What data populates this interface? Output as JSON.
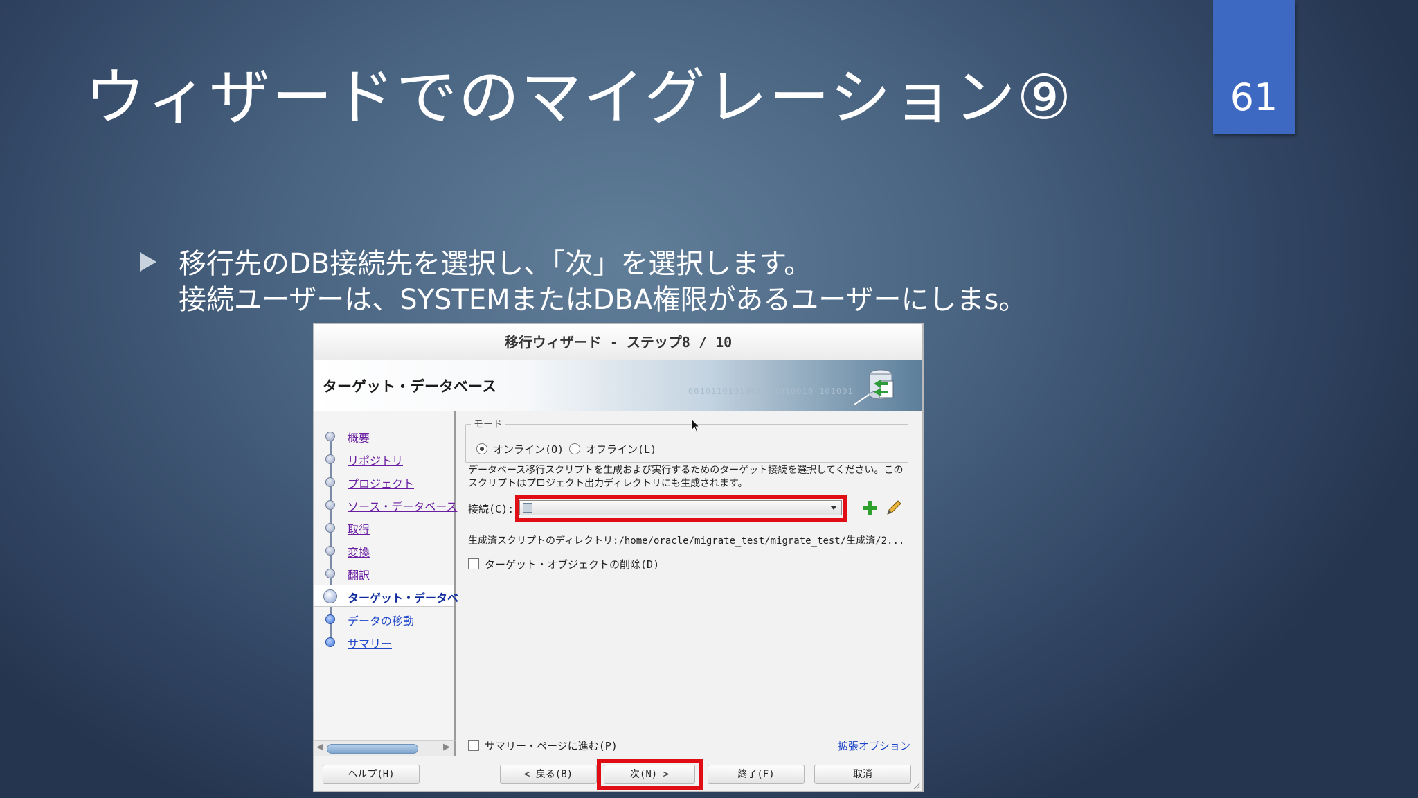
{
  "slide": {
    "title": "ウィザードでのマイグレーション⑨",
    "page_number": "61",
    "bullet_line1": "移行先のDB接続先を選択し、「次」を選択します。",
    "bullet_line2": "接続ユーザーは、SYSTEMまたはDBA権限があるユーザーにしまs。"
  },
  "dialog": {
    "title": "移行ウィザード - ステップ8 / 10",
    "header": "ターゲット・データベース",
    "header_digits": "0010110101001011010010 101001",
    "nav": [
      {
        "label": "概要"
      },
      {
        "label": "リポジトリ"
      },
      {
        "label": "プロジェクト"
      },
      {
        "label": "ソース・データベース"
      },
      {
        "label": "取得"
      },
      {
        "label": "変換"
      },
      {
        "label": "翻訳"
      },
      {
        "label": "ターゲット・データベ"
      },
      {
        "label": "データの移動"
      },
      {
        "label": "サマリー"
      }
    ],
    "mode": {
      "legend": "モード",
      "online": "オンライン(O)",
      "offline": "オフライン(L)",
      "selected": "online"
    },
    "description": "データベース移行スクリプトを生成および実行するためのターゲット接続を選択してください。このスクリプトはプロジェクト出力ディレクトリにも生成されます。",
    "connection_label": "接続(C):",
    "connection_value": "",
    "directory_line": "生成済スクリプトのディレクトリ:/home/oracle/migrate_test/migrate_test/生成済/2...",
    "drop_objects_label": "ターゲット・オブジェクトの削除(D)",
    "skip_to_summary_label": "サマリー・ページに進む(P)",
    "advanced_options": "拡張オプション",
    "buttons": {
      "help": "ヘルプ(H)",
      "back": "< 戻る(B)",
      "next": "次(N) >",
      "finish": "終了(F)",
      "cancel": "取消"
    }
  },
  "colors": {
    "highlight_red": "#e10d14",
    "page_number_bg": "#3e69c2",
    "link_purple": "#6a1fa2",
    "link_blue": "#1d46c8"
  }
}
